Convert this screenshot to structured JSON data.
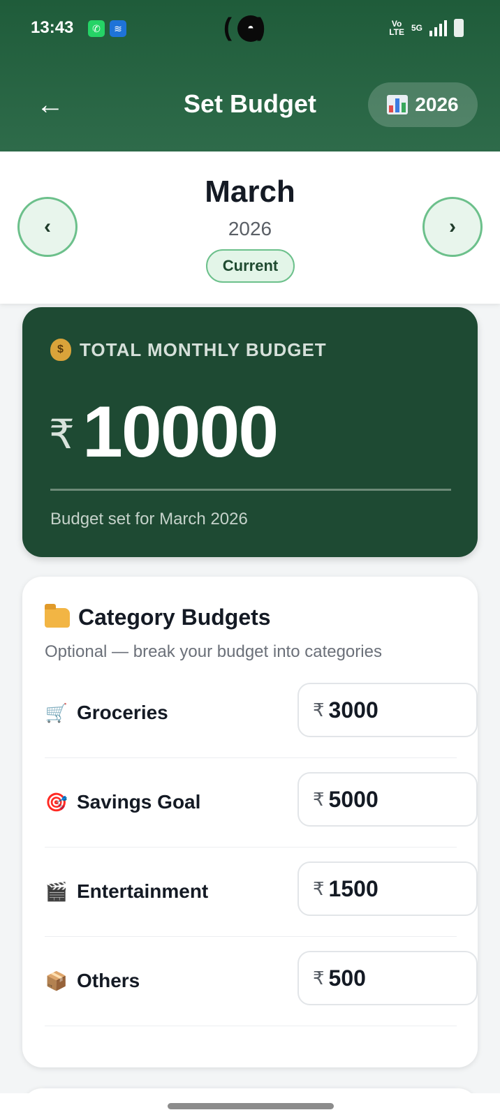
{
  "status_bar": {
    "time": "13:43",
    "network_label_top": "Vo",
    "network_label_bottom": "LTE",
    "signal_label": "5G"
  },
  "header": {
    "back_glyph": "←",
    "title": "Set Budget",
    "year_button": "2026",
    "year_icon": "bar-chart-icon"
  },
  "month_nav": {
    "prev_glyph": "‹",
    "next_glyph": "›",
    "month": "March",
    "year": "2026",
    "badge": "Current"
  },
  "budget_card": {
    "icon": "money-bag-icon",
    "label": "TOTAL MONTHLY BUDGET",
    "currency": "₹",
    "amount": "10000",
    "note": "Budget set for March 2026"
  },
  "category_card": {
    "icon": "folder-icon",
    "title": "Category Budgets",
    "subtitle": "Optional — break your budget into categories",
    "currency": "₹",
    "items": [
      {
        "icon": "🛒",
        "name": "Groceries",
        "value": "3000"
      },
      {
        "icon": "🎯",
        "name": "Savings Goal",
        "value": "5000"
      },
      {
        "icon": "🎬",
        "name": "Entertainment",
        "value": "1500"
      },
      {
        "icon": "📦",
        "name": "Others",
        "value": "500"
      }
    ]
  },
  "colors": {
    "header": "#1f5c3a",
    "budget_card": "#1e4a33",
    "accent_green": "#6cc08b"
  }
}
